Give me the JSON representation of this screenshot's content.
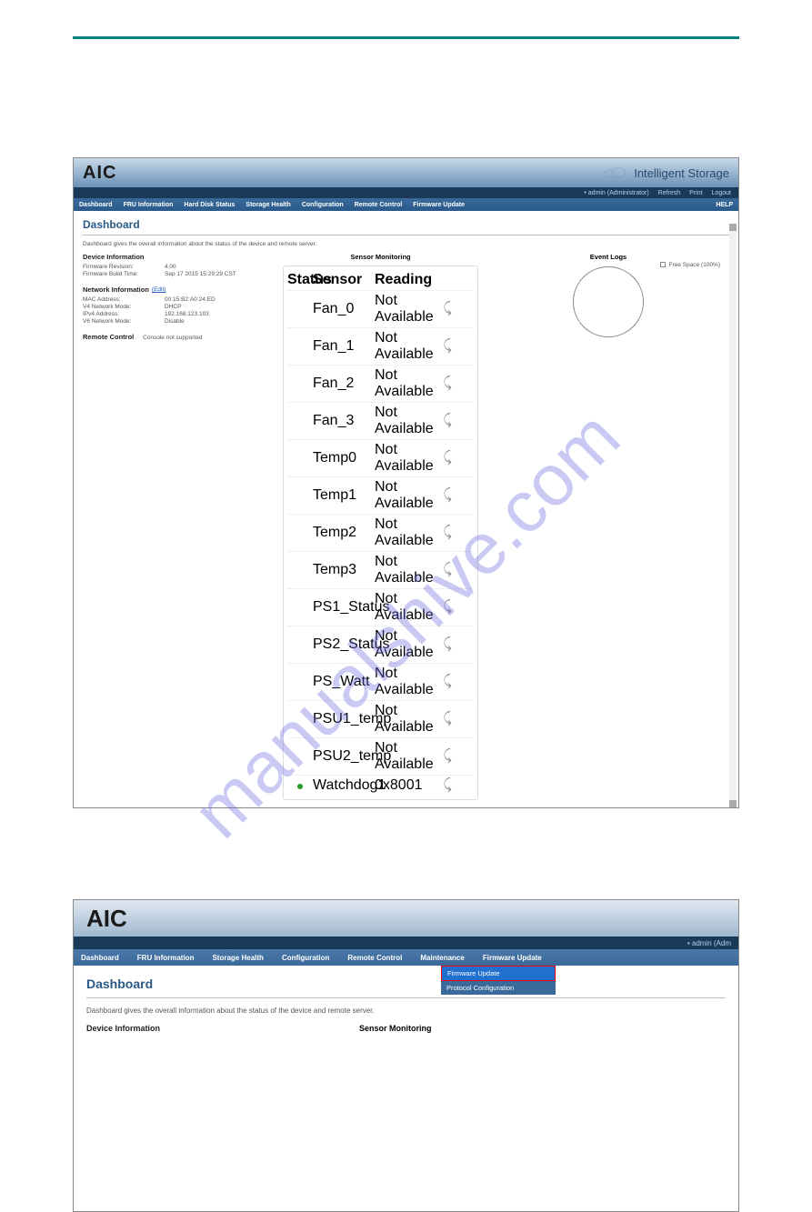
{
  "watermark": "manualshive.com",
  "screenshot1": {
    "logo": "AIC",
    "brand": "Intelligent Storage",
    "user_info": "• admin (Administrator)",
    "refresh": "Refresh",
    "print": "Print",
    "logout": "Logout",
    "nav": [
      "Dashboard",
      "FRU Information",
      "Hard Disk Status",
      "Storage Health",
      "Configuration",
      "Remote Control",
      "Firmware Update"
    ],
    "help": "HELP",
    "title": "Dashboard",
    "desc": "Dashboard gives the overall information about the status of the device and remote server.",
    "device_info": {
      "title": "Device Information",
      "rows": [
        {
          "label": "Firmware Revision:",
          "value": "4.00"
        },
        {
          "label": "Firmware Build Time:",
          "value": "Sep 17 2015 15:29:29 CST"
        }
      ]
    },
    "network_info": {
      "title": "Network Information",
      "edit": "(Edit)",
      "rows": [
        {
          "label": "MAC Address:",
          "value": "00:15:B2:A0:24:ED"
        },
        {
          "label": "V4 Network Mode:",
          "value": "DHCP"
        },
        {
          "label": "IPv4 Address:",
          "value": "192.168.123.103"
        },
        {
          "label": "V6 Network Mode:",
          "value": "Disable"
        }
      ]
    },
    "remote_control": {
      "title": "Remote Control",
      "value": "Console not supported"
    },
    "sensor": {
      "title": "Sensor Monitoring",
      "headers": {
        "status": "Status",
        "sensor": "Sensor",
        "reading": "Reading"
      },
      "rows": [
        {
          "status": "",
          "sensor": "Fan_0",
          "reading": "Not Available"
        },
        {
          "status": "",
          "sensor": "Fan_1",
          "reading": "Not Available"
        },
        {
          "status": "",
          "sensor": "Fan_2",
          "reading": "Not Available"
        },
        {
          "status": "",
          "sensor": "Fan_3",
          "reading": "Not Available"
        },
        {
          "status": "",
          "sensor": "Temp0",
          "reading": "Not Available"
        },
        {
          "status": "",
          "sensor": "Temp1",
          "reading": "Not Available"
        },
        {
          "status": "",
          "sensor": "Temp2",
          "reading": "Not Available"
        },
        {
          "status": "",
          "sensor": "Temp3",
          "reading": "Not Available"
        },
        {
          "status": "",
          "sensor": "PS1_Status",
          "reading": "Not Available"
        },
        {
          "status": "",
          "sensor": "PS2_Status",
          "reading": "Not Available"
        },
        {
          "status": "",
          "sensor": "PS_Watt",
          "reading": "Not Available"
        },
        {
          "status": "",
          "sensor": "PSU1_temp",
          "reading": "Not Available"
        },
        {
          "status": "",
          "sensor": "PSU2_temp",
          "reading": "Not Available"
        },
        {
          "status": "green",
          "sensor": "Watchdog1",
          "reading": "0x8001"
        }
      ]
    },
    "event_logs": {
      "title": "Event Logs",
      "legend": "Free Space (100%)"
    }
  },
  "screenshot2": {
    "logo": "AIC",
    "user_info": "• admin (Adm",
    "nav": [
      "Dashboard",
      "FRU Information",
      "Storage Health",
      "Configuration",
      "Remote Control",
      "Maintenance",
      "Firmware Update"
    ],
    "dropdown": [
      {
        "label": "Firmware Update",
        "selected": true
      },
      {
        "label": "Protocol Configuration",
        "selected": false
      }
    ],
    "title": "Dashboard",
    "desc": "Dashboard gives the overall information about the status of the device and remote server.",
    "device_info_title": "Device Information",
    "sensor_title": "Sensor Monitoring"
  }
}
